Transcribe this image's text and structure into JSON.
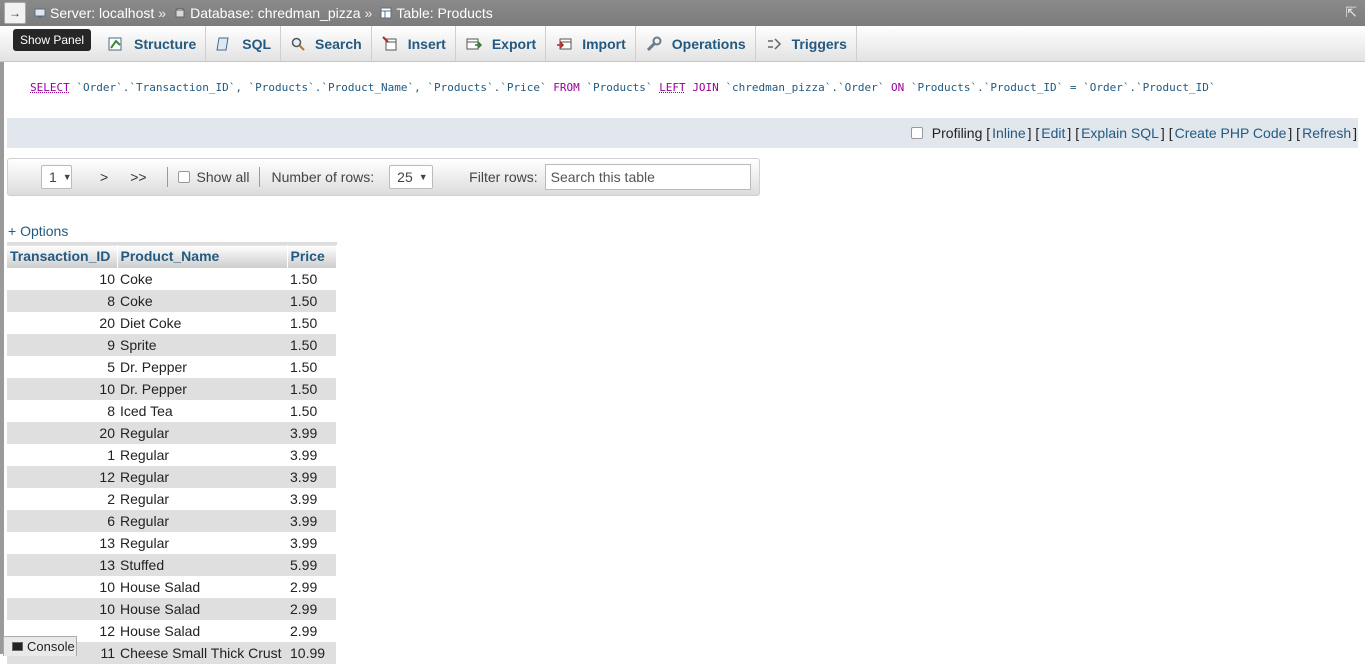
{
  "breadcrumb": {
    "server": "Server: localhost",
    "database": "Database: chredman_pizza",
    "table": "Table: Products",
    "separator": "»"
  },
  "nav_toggle": "→",
  "show_panel": "Show Panel",
  "tabs": [
    {
      "label": "Structure",
      "icon": "structure-icon"
    },
    {
      "label": "SQL",
      "icon": "sql-icon"
    },
    {
      "label": "Search",
      "icon": "search-icon"
    },
    {
      "label": "Insert",
      "icon": "insert-icon"
    },
    {
      "label": "Export",
      "icon": "export-icon"
    },
    {
      "label": "Import",
      "icon": "import-icon"
    },
    {
      "label": "Operations",
      "icon": "operations-icon"
    },
    {
      "label": "Triggers",
      "icon": "triggers-icon"
    }
  ],
  "sql": {
    "select": "SELECT",
    "c1": "`Order`.`Transaction_ID`, `Products`.`Product_Name`, `Products`.`Price`",
    "from": "FROM",
    "t1": "`Products`",
    "left": "LEFT",
    "join": "JOIN",
    "t2": "`chredman_pizza`.`Order`",
    "on": "ON",
    "cond": "`Products`.`Product_ID` = `Order`.`Product_ID`"
  },
  "profiling": {
    "label": "Profiling",
    "links": [
      "Inline",
      "Edit",
      "Explain SQL",
      "Create PHP Code",
      "Refresh"
    ]
  },
  "navigation": {
    "page": "1",
    "next": ">",
    "last": ">>",
    "show_all": "Show all",
    "rows_label": "Number of rows:",
    "rows_value": "25",
    "filter_label": "Filter rows:",
    "filter_placeholder": "Search this table"
  },
  "options_link": "+ Options",
  "table": {
    "columns": [
      "Transaction_ID",
      "Product_Name",
      "Price"
    ],
    "rows": [
      [
        "10",
        "Coke",
        "1.50"
      ],
      [
        "8",
        "Coke",
        "1.50"
      ],
      [
        "20",
        "Diet Coke",
        "1.50"
      ],
      [
        "9",
        "Sprite",
        "1.50"
      ],
      [
        "5",
        "Dr. Pepper",
        "1.50"
      ],
      [
        "10",
        "Dr. Pepper",
        "1.50"
      ],
      [
        "8",
        "Iced Tea",
        "1.50"
      ],
      [
        "20",
        "Regular",
        "3.99"
      ],
      [
        "1",
        "Regular",
        "3.99"
      ],
      [
        "12",
        "Regular",
        "3.99"
      ],
      [
        "2",
        "Regular",
        "3.99"
      ],
      [
        "6",
        "Regular",
        "3.99"
      ],
      [
        "13",
        "Regular",
        "3.99"
      ],
      [
        "13",
        "Stuffed",
        "5.99"
      ],
      [
        "10",
        "House Salad",
        "2.99"
      ],
      [
        "10",
        "House Salad",
        "2.99"
      ],
      [
        "12",
        "House Salad",
        "2.99"
      ],
      [
        "11",
        "Cheese Small Thick Crust",
        "10.99"
      ]
    ]
  },
  "console": "Console",
  "colors": {
    "link": "#235a81",
    "sql_keyword": "#990099",
    "profile_bar": "#e1e7ec",
    "topbar": "#838383"
  }
}
